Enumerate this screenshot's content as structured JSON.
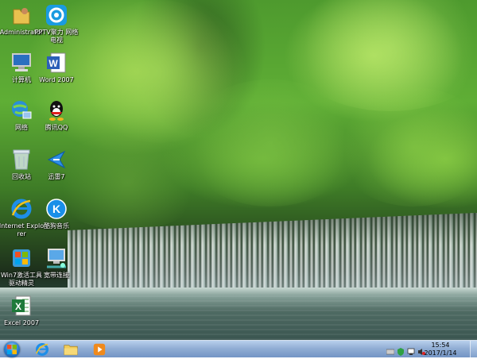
{
  "desktop": {
    "icons": [
      {
        "label": "Administrator",
        "icon": "user-folder-icon"
      },
      {
        "label": "PPTV聚力 网络电视",
        "icon": "pptv-icon"
      },
      {
        "label": "计算机",
        "icon": "computer-icon"
      },
      {
        "label": "Word 2007",
        "icon": "word-icon"
      },
      {
        "label": "网络",
        "icon": "network-icon"
      },
      {
        "label": "腾讯QQ",
        "icon": "qq-icon"
      },
      {
        "label": "回收站",
        "icon": "recycle-bin-icon"
      },
      {
        "label": "迅雷7",
        "icon": "thunder-icon"
      },
      {
        "label": "Internet Explorer",
        "icon": "internet-explorer-icon"
      },
      {
        "label": "酷狗音乐",
        "icon": "kugou-icon"
      },
      {
        "label": "Win7激活工具驱动精灵",
        "icon": "activation-tool-icon"
      },
      {
        "label": "宽带连接",
        "icon": "broadband-icon"
      },
      {
        "label": "Excel 2007",
        "icon": "excel-icon"
      }
    ]
  },
  "taskbar": {
    "pinned": [
      {
        "name": "Internet Explorer",
        "icon": "internet-explorer-icon"
      },
      {
        "name": "Windows Explorer",
        "icon": "folder-icon"
      },
      {
        "name": "Media Player",
        "icon": "media-player-icon"
      }
    ],
    "tray_icons": [
      "keyboard-icon",
      "shield-icon",
      "network-icon",
      "volume-icon"
    ],
    "clock": {
      "time": "15:54",
      "date": "2017/1/14"
    }
  }
}
